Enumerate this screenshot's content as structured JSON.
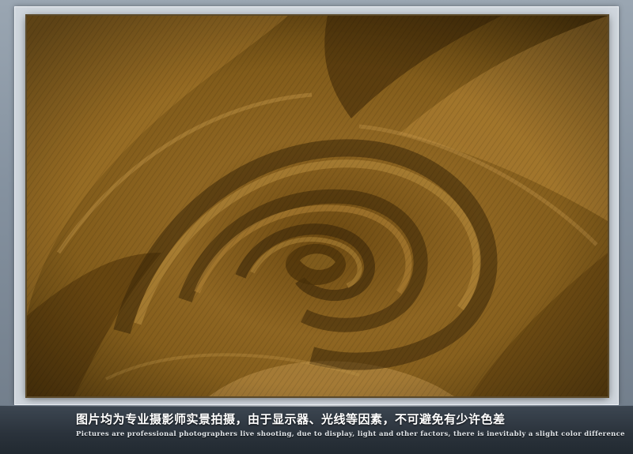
{
  "photo": {
    "subject": "folded-twill-fabric-swirl",
    "colors": {
      "base": "#8a6420",
      "highlight": "#b58a3c",
      "shadow": "#3a2608",
      "frame": "#8592a0",
      "band": "#2a323b"
    }
  },
  "caption": {
    "chinese": "图片均为专业摄影师实景拍摄，由于显示器、光线等因素，不可避免有少许色差",
    "english": "Pictures are professional photographers live shooting, due to display, light and other factors, there is inevitably a slight color difference"
  }
}
